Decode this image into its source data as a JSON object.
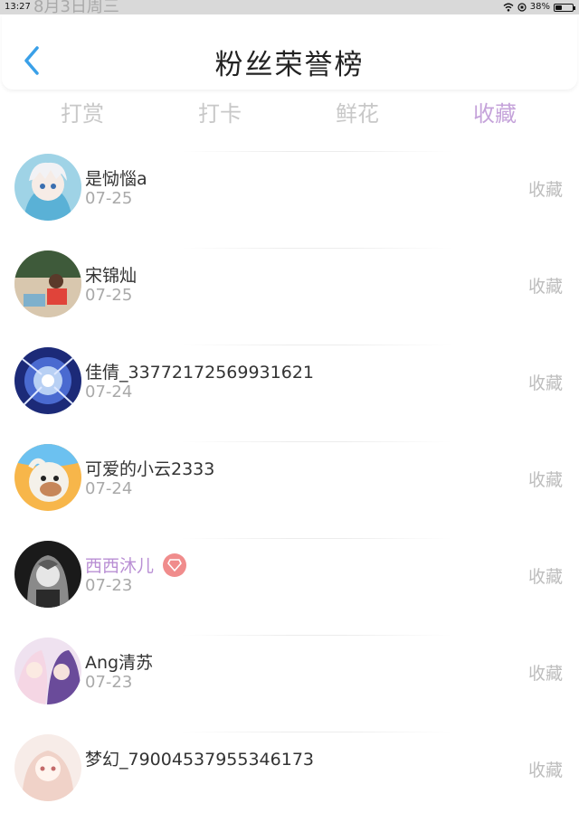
{
  "status_bar": {
    "time": "13:27",
    "date": "8月3日周三",
    "battery": "38%",
    "battery_level": 0.38
  },
  "header": {
    "title": "粉丝荣誉榜"
  },
  "tabs": [
    {
      "label": "打赏",
      "active": false
    },
    {
      "label": "打卡",
      "active": false
    },
    {
      "label": "鲜花",
      "active": false
    },
    {
      "label": "收藏",
      "active": true
    }
  ],
  "fans": [
    {
      "name": "是恸惱a",
      "date": "07-25",
      "action": "收藏",
      "vip": false
    },
    {
      "name": "宋锦灿",
      "date": "07-25",
      "action": "收藏",
      "vip": false
    },
    {
      "name": "佳倩_3377217256993162​1",
      "date": "07-24",
      "action": "收藏",
      "vip": false
    },
    {
      "name": "可爱的小云2333",
      "date": "07-24",
      "action": "收藏",
      "vip": false
    },
    {
      "name": "西西沐儿",
      "date": "07-23",
      "action": "收藏",
      "vip": true
    },
    {
      "name": "Ang清苏",
      "date": "07-23",
      "action": "收藏",
      "vip": false
    },
    {
      "name": "梦幻_79004537955346173",
      "date": "",
      "action": "收藏",
      "vip": false
    }
  ],
  "colors": {
    "accent": "#c5a3da",
    "back_arrow": "#3aa0e8",
    "vip_badge": "#f08c8c"
  }
}
